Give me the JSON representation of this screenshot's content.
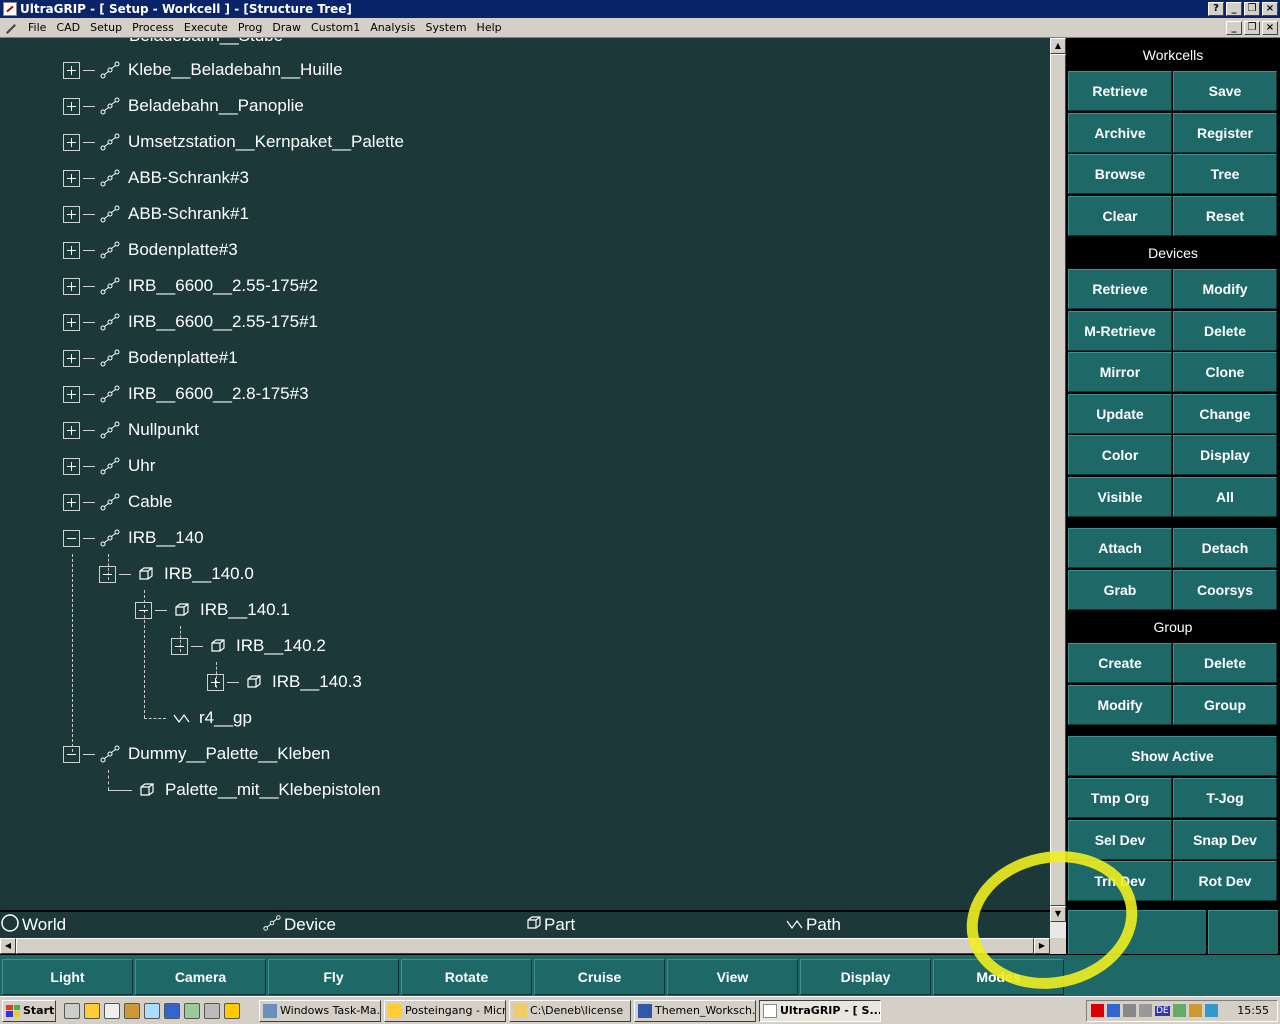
{
  "window": {
    "title": "UltraGRIP - [ Setup - Workcell ] - [Structure Tree]"
  },
  "menu": [
    "File",
    "CAD",
    "Setup",
    "Process",
    "Execute",
    "Prog",
    "Draw",
    "Custom1",
    "Analysis",
    "System",
    "Help"
  ],
  "tree": {
    "partial_top_label": "Beladebahn__Stube",
    "devices": [
      "Klebe__Beladebahn__Huille",
      "Beladebahn__Panoplie",
      "Umsetzstation__Kernpaket__Palette",
      "ABB-Schrank#3",
      "ABB-Schrank#1",
      "Bodenplatte#3",
      "IRB__6600__2.55-175#2",
      "IRB__6600__2.55-175#1",
      "Bodenplatte#1",
      "IRB__6600__2.8-175#3",
      "Nullpunkt",
      "Uhr",
      "Cable",
      "IRB__140"
    ],
    "irb140_children": {
      "part0": "IRB__140.0",
      "part1": "IRB__140.1",
      "part2": "IRB__140.2",
      "part3": "IRB__140.3",
      "path": "r4__gp"
    },
    "dummy": "Dummy__Palette__Kleben",
    "dummy_child": "Palette__mit__Klebepistolen"
  },
  "modes": {
    "world": "World",
    "device": "Device",
    "part": "Part",
    "path": "Path"
  },
  "panel": {
    "workcells_header": "Workcells",
    "workcells": [
      "Retrieve",
      "Save",
      "Archive",
      "Register",
      "Browse",
      "Tree",
      "Clear",
      "Reset"
    ],
    "devices_header": "Devices",
    "devices": [
      "Retrieve",
      "Modify",
      "M-Retrieve",
      "Delete",
      "Mirror",
      "Clone",
      "Update",
      "Change",
      "Color",
      "Display",
      "Visible",
      "All"
    ],
    "attach_group": [
      "Attach",
      "Detach",
      "Grab",
      "Coorsys"
    ],
    "group_header": "Group",
    "group": [
      "Create",
      "Delete",
      "Modify",
      "Group"
    ],
    "show_active": "Show Active",
    "tools": [
      "Tmp Org",
      "T-Jog",
      "Sel Dev",
      "Snap Dev",
      "Trn Dev",
      "Rot Dev"
    ]
  },
  "toolbar": [
    "Light",
    "Camera",
    "Fly",
    "Rotate",
    "Cruise",
    "View",
    "Display",
    "Modes"
  ],
  "taskbar": {
    "start": "Start",
    "tasks": [
      "Windows Task-Ma...",
      "Posteingang - Micr...",
      "C:\\Deneb\\license",
      "Themen_Worksch...",
      "UltraGRIP - [ S..."
    ],
    "tray_lang": "DE",
    "clock": "15:55"
  },
  "colors": {
    "tree_bg": "#1c3838",
    "button_teal": "#1f6868",
    "title_blue": "#0a246a",
    "highlight_yellow": "#f0ee20"
  },
  "icons": {
    "device": "device-linkage-icon",
    "part": "part-cube-icon",
    "path": "path-zigzag-icon",
    "world": "world-circle-icon"
  }
}
